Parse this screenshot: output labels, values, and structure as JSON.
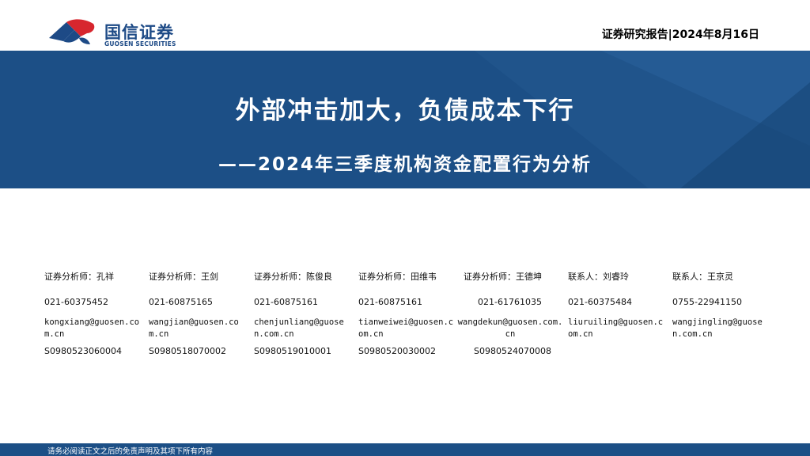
{
  "header": {
    "logo_cn": "国信证券",
    "logo_en": "GUOSEN SECURITIES",
    "report_tag": "证券研究报告|2024年8月16日"
  },
  "banner": {
    "title": "外部冲击加大，负债成本下行",
    "subtitle": "——2024年三季度机构资金配置行为分析"
  },
  "analysts": [
    {
      "name": "证券分析师：孔祥",
      "phone": "021-60375452",
      "email": "kongxiang@guosen.com.cn",
      "cert": "S0980523060004"
    },
    {
      "name": "证券分析师：王剑",
      "phone": "021-60875165",
      "email": "wangjian@guosen.com.cn",
      "cert": "S0980518070002"
    },
    {
      "name": "证券分析师：陈俊良",
      "phone": "021-60875161",
      "email": "chenjunliang@guosen.com.cn",
      "cert": "S0980519010001"
    },
    {
      "name": "证券分析师：田维韦",
      "phone": "021-60875161",
      "email": "tianweiwei@guosen.com.cn",
      "cert": "S0980520030002"
    },
    {
      "name": "证券分析师：王德坤",
      "phone": "021-61761035",
      "email": "wangdekun@guosen.com.cn",
      "cert": "S0980524070008"
    },
    {
      "name": "联系人：刘睿玲",
      "phone": "021-60375484",
      "email": "liuruiling@guosen.com.cn",
      "cert": ""
    },
    {
      "name": "联系人：王京灵",
      "phone": "0755-22941150",
      "email": "wangjingling@guosen.com.cn",
      "cert": ""
    }
  ],
  "footer": {
    "disclaimer": "请务必阅读正文之后的免责声明及其项下所有内容"
  },
  "colors": {
    "brand_blue": "#1c4f86",
    "logo_red": "#d7262e"
  },
  "icons": {
    "logo": "guosen-logo-icon"
  }
}
